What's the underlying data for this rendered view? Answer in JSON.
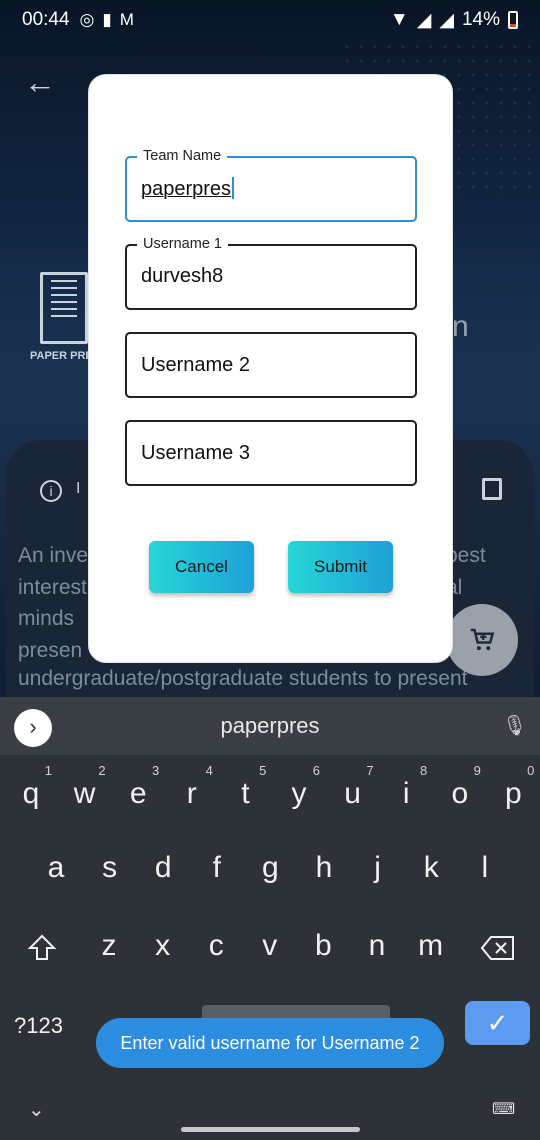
{
  "status_bar": {
    "time": "00:44",
    "battery": "14%"
  },
  "background": {
    "logo_text": "PAPER PRE",
    "info_tab": "I",
    "about_lines": [
      "An inve",
      "interest",
      "minds",
      "presen"
    ],
    "about_right": [
      "best",
      "al"
    ],
    "about_bottom": "undergraduate/postgraduate students to present",
    "shadow_char": "n"
  },
  "dialog": {
    "fields": [
      {
        "label": "Team Name",
        "value": "paperpres"
      },
      {
        "label": "Username 1",
        "value": "durvesh8"
      },
      {
        "placeholder": "Username 2"
      },
      {
        "placeholder": "Username 3"
      }
    ],
    "cancel_label": "Cancel",
    "submit_label": "Submit"
  },
  "keyboard": {
    "suggestion": "paperpres",
    "row1": [
      {
        "k": "q",
        "h": "1"
      },
      {
        "k": "w",
        "h": "2"
      },
      {
        "k": "e",
        "h": "3"
      },
      {
        "k": "r",
        "h": "4"
      },
      {
        "k": "t",
        "h": "5"
      },
      {
        "k": "y",
        "h": "6"
      },
      {
        "k": "u",
        "h": "7"
      },
      {
        "k": "i",
        "h": "8"
      },
      {
        "k": "o",
        "h": "9"
      },
      {
        "k": "p",
        "h": "0"
      }
    ],
    "row2": [
      "a",
      "s",
      "d",
      "f",
      "g",
      "h",
      "j",
      "k",
      "l"
    ],
    "row3": [
      "z",
      "x",
      "c",
      "v",
      "b",
      "n",
      "m"
    ],
    "symbols_label": "?123",
    "enter_glyph": "✓"
  },
  "toast": "Enter valid username for Username 2",
  "colors": {
    "accent": "#2f8fd6",
    "button_gradient_start": "#26d6d6",
    "button_gradient_end": "#1fa0d8",
    "toast_bg": "#2c8de0",
    "enter_key": "#5d9bf0"
  }
}
